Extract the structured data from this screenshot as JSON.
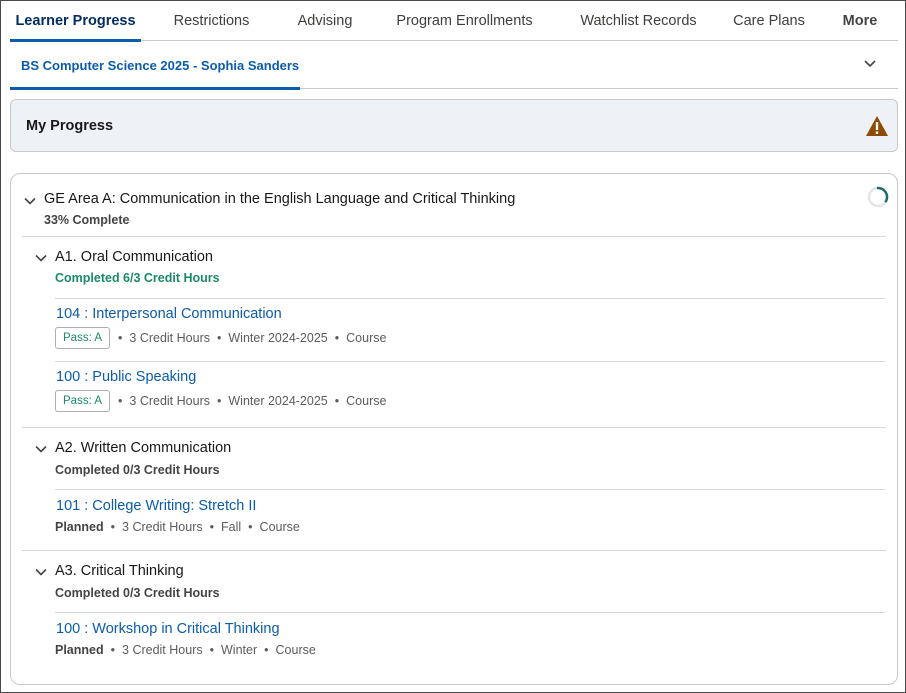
{
  "tabs": [
    {
      "label": "Learner Progress",
      "active": true
    },
    {
      "label": "Restrictions"
    },
    {
      "label": "Advising"
    },
    {
      "label": "Program Enrollments"
    },
    {
      "label": "Watchlist Records"
    },
    {
      "label": "Care Plans"
    },
    {
      "label": "More"
    }
  ],
  "subtab": {
    "label": "BS Computer Science 2025 - Sophia Sanders"
  },
  "progress": {
    "title": "My Progress"
  },
  "area": {
    "title": "GE Area A: Communication in the English Language and Critical Thinking",
    "status": "33% Complete",
    "fraction": 0.33
  },
  "sections": [
    {
      "title": "A1. Oral Communication",
      "status": "Completed 6/3 Credit Hours",
      "courses": [
        {
          "name": "104 : Interpersonal Communication",
          "badge": "Pass: A",
          "credits": "3 Credit Hours",
          "term": "Winter 2024-2025",
          "type": "Course"
        },
        {
          "name": "100 : Public Speaking",
          "badge": "Pass: A",
          "credits": "3 Credit Hours",
          "term": "Winter 2024-2025",
          "type": "Course"
        }
      ]
    },
    {
      "title": "A2. Written Communication",
      "status": "Completed 0/3 Credit Hours",
      "courses": [
        {
          "name": "101 : College Writing: Stretch II",
          "state": "Planned",
          "credits": "3 Credit Hours",
          "term": "Fall",
          "type": "Course"
        }
      ]
    },
    {
      "title": "A3. Critical Thinking",
      "status": "Completed 0/3 Credit Hours",
      "courses": [
        {
          "name": "100 : Workshop in Critical Thinking",
          "state": "Planned",
          "credits": "3 Credit Hours",
          "term": "Winter",
          "type": "Course"
        }
      ]
    }
  ],
  "dot": "•",
  "colors": {
    "accent": "#0b5cab",
    "success": "#1b8a6b",
    "warning": "#8c4b02"
  }
}
